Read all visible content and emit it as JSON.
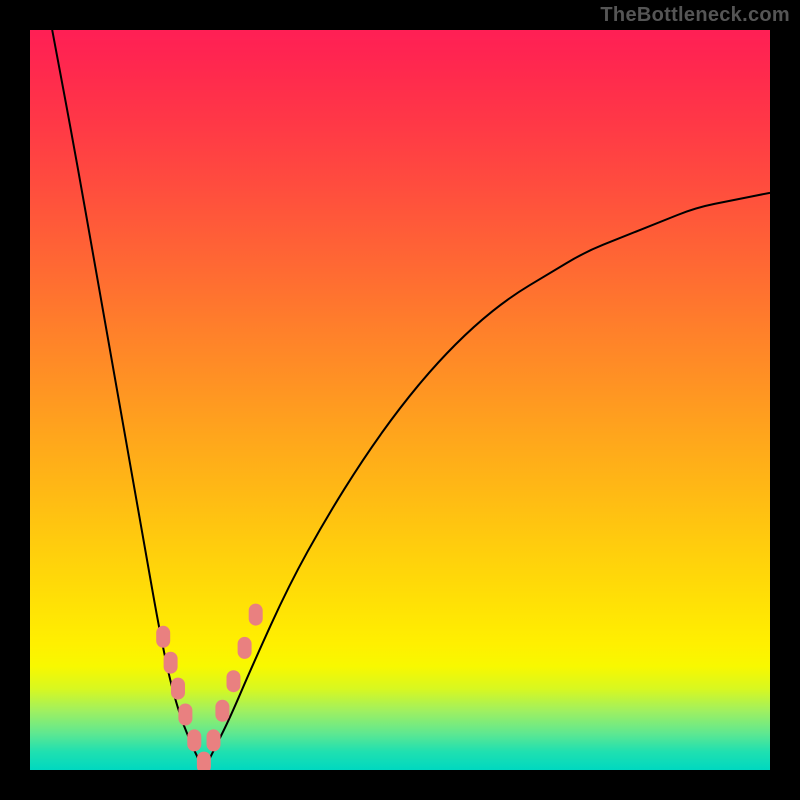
{
  "watermark": "TheBottleneck.com",
  "chart_data": {
    "type": "line",
    "title": "",
    "xlabel": "",
    "ylabel": "",
    "xlim": [
      0,
      1
    ],
    "ylim": [
      0,
      1
    ],
    "minimum_x": 0.235,
    "description": "Single V-shaped curve on a vertical red→yellow→green gradient; minimum (green/optimal) near x≈0.24 of the horizontal range; left branch steeper than right branch which rises to ≈0.75 of height at x=1.",
    "series": [
      {
        "name": "main-curve",
        "color": "#000000",
        "x": [
          0.03,
          0.06,
          0.09,
          0.12,
          0.15,
          0.18,
          0.2,
          0.22,
          0.235,
          0.25,
          0.27,
          0.3,
          0.35,
          0.4,
          0.45,
          0.5,
          0.55,
          0.6,
          0.65,
          0.7,
          0.75,
          0.8,
          0.85,
          0.9,
          0.95,
          1.0
        ],
        "y": [
          1.0,
          0.84,
          0.67,
          0.5,
          0.33,
          0.16,
          0.08,
          0.03,
          0.0,
          0.03,
          0.07,
          0.14,
          0.25,
          0.34,
          0.42,
          0.49,
          0.55,
          0.6,
          0.64,
          0.67,
          0.7,
          0.72,
          0.74,
          0.76,
          0.77,
          0.78
        ]
      },
      {
        "name": "highlight-markers",
        "color": "#e98080",
        "marker_shape": "rounded-square",
        "x": [
          0.18,
          0.19,
          0.2,
          0.21,
          0.222,
          0.235,
          0.248,
          0.26,
          0.275,
          0.29,
          0.305
        ],
        "y": [
          0.18,
          0.145,
          0.11,
          0.075,
          0.04,
          0.01,
          0.04,
          0.08,
          0.12,
          0.165,
          0.21
        ]
      }
    ],
    "gradient_stops": [
      {
        "pos": 0.0,
        "color": "#ff1f55"
      },
      {
        "pos": 0.5,
        "color": "#ff9a20"
      },
      {
        "pos": 0.83,
        "color": "#fff000"
      },
      {
        "pos": 1.0,
        "color": "#00d8c0"
      }
    ]
  }
}
